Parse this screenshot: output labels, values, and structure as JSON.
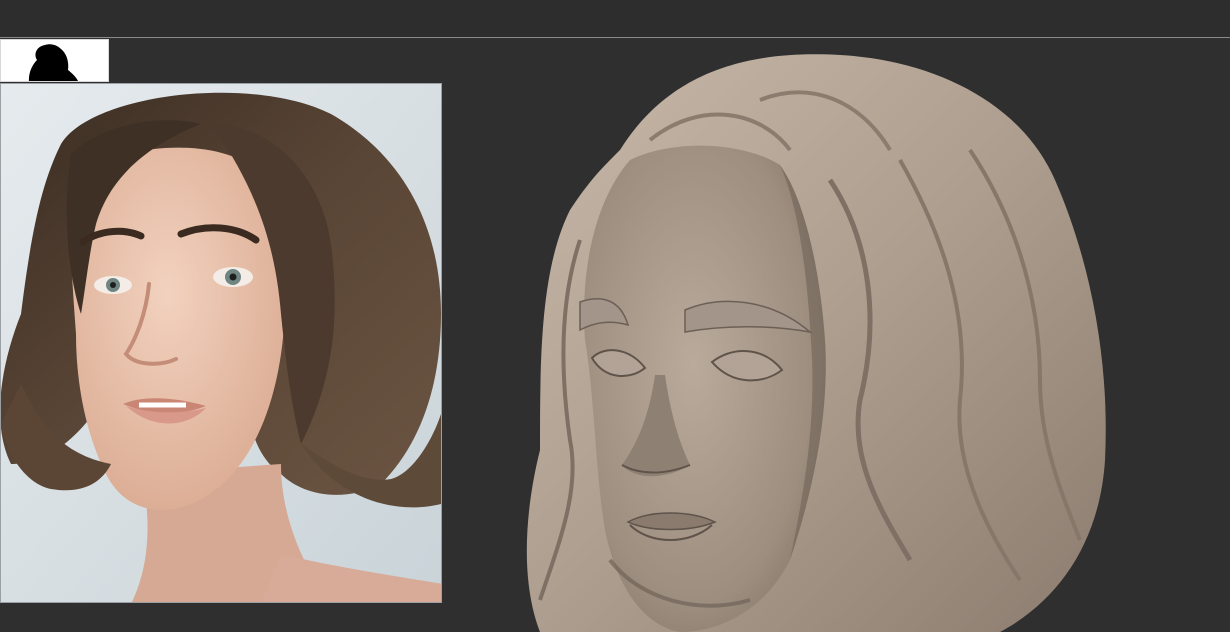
{
  "window": {
    "app": "sculpt-viewport-with-reference"
  },
  "colors": {
    "background": "#2f2f2f",
    "top_bar": "#2d2d2d",
    "divider": "#8a8a8a",
    "thumb_bg": "#ffffff",
    "photo_bg": "#dfe6ea",
    "skin": "#e9c3ad",
    "hair": "#4a3a2c",
    "clay": "#a8988a",
    "clay_shadow": "#776a5f",
    "clay_light": "#cbbdb0"
  },
  "icons": {
    "thumb": "head-silhouette-icon"
  }
}
